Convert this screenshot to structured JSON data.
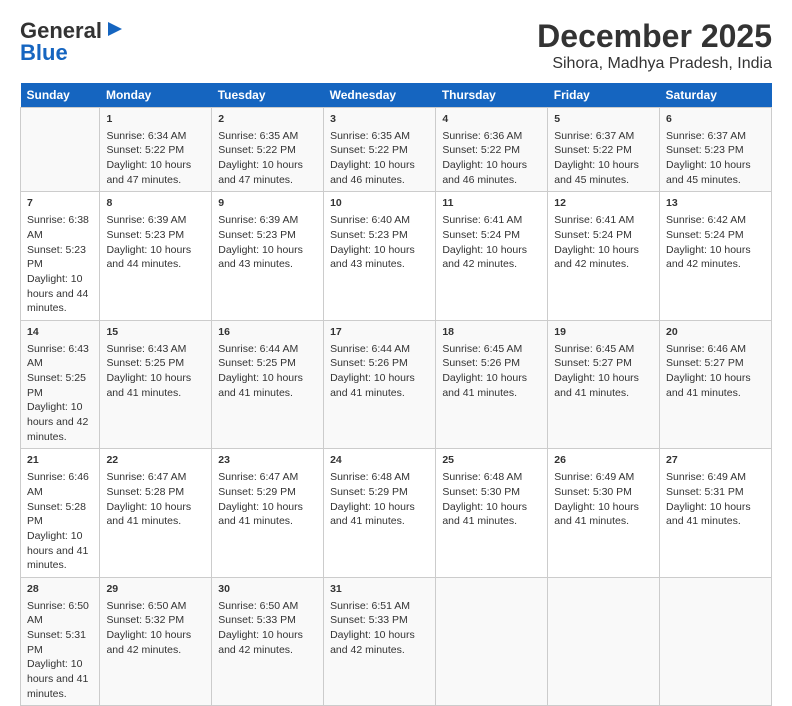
{
  "logo": {
    "line1": "General",
    "line2": "Blue"
  },
  "title": "December 2025",
  "subtitle": "Sihora, Madhya Pradesh, India",
  "days_header": [
    "Sunday",
    "Monday",
    "Tuesday",
    "Wednesday",
    "Thursday",
    "Friday",
    "Saturday"
  ],
  "weeks": [
    [
      {
        "day": "",
        "sunrise": "",
        "sunset": "",
        "daylight": ""
      },
      {
        "day": "1",
        "sunrise": "Sunrise: 6:34 AM",
        "sunset": "Sunset: 5:22 PM",
        "daylight": "Daylight: 10 hours and 47 minutes."
      },
      {
        "day": "2",
        "sunrise": "Sunrise: 6:35 AM",
        "sunset": "Sunset: 5:22 PM",
        "daylight": "Daylight: 10 hours and 47 minutes."
      },
      {
        "day": "3",
        "sunrise": "Sunrise: 6:35 AM",
        "sunset": "Sunset: 5:22 PM",
        "daylight": "Daylight: 10 hours and 46 minutes."
      },
      {
        "day": "4",
        "sunrise": "Sunrise: 6:36 AM",
        "sunset": "Sunset: 5:22 PM",
        "daylight": "Daylight: 10 hours and 46 minutes."
      },
      {
        "day": "5",
        "sunrise": "Sunrise: 6:37 AM",
        "sunset": "Sunset: 5:22 PM",
        "daylight": "Daylight: 10 hours and 45 minutes."
      },
      {
        "day": "6",
        "sunrise": "Sunrise: 6:37 AM",
        "sunset": "Sunset: 5:23 PM",
        "daylight": "Daylight: 10 hours and 45 minutes."
      }
    ],
    [
      {
        "day": "7",
        "sunrise": "Sunrise: 6:38 AM",
        "sunset": "Sunset: 5:23 PM",
        "daylight": "Daylight: 10 hours and 44 minutes."
      },
      {
        "day": "8",
        "sunrise": "Sunrise: 6:39 AM",
        "sunset": "Sunset: 5:23 PM",
        "daylight": "Daylight: 10 hours and 44 minutes."
      },
      {
        "day": "9",
        "sunrise": "Sunrise: 6:39 AM",
        "sunset": "Sunset: 5:23 PM",
        "daylight": "Daylight: 10 hours and 43 minutes."
      },
      {
        "day": "10",
        "sunrise": "Sunrise: 6:40 AM",
        "sunset": "Sunset: 5:23 PM",
        "daylight": "Daylight: 10 hours and 43 minutes."
      },
      {
        "day": "11",
        "sunrise": "Sunrise: 6:41 AM",
        "sunset": "Sunset: 5:24 PM",
        "daylight": "Daylight: 10 hours and 42 minutes."
      },
      {
        "day": "12",
        "sunrise": "Sunrise: 6:41 AM",
        "sunset": "Sunset: 5:24 PM",
        "daylight": "Daylight: 10 hours and 42 minutes."
      },
      {
        "day": "13",
        "sunrise": "Sunrise: 6:42 AM",
        "sunset": "Sunset: 5:24 PM",
        "daylight": "Daylight: 10 hours and 42 minutes."
      }
    ],
    [
      {
        "day": "14",
        "sunrise": "Sunrise: 6:43 AM",
        "sunset": "Sunset: 5:25 PM",
        "daylight": "Daylight: 10 hours and 42 minutes."
      },
      {
        "day": "15",
        "sunrise": "Sunrise: 6:43 AM",
        "sunset": "Sunset: 5:25 PM",
        "daylight": "Daylight: 10 hours and 41 minutes."
      },
      {
        "day": "16",
        "sunrise": "Sunrise: 6:44 AM",
        "sunset": "Sunset: 5:25 PM",
        "daylight": "Daylight: 10 hours and 41 minutes."
      },
      {
        "day": "17",
        "sunrise": "Sunrise: 6:44 AM",
        "sunset": "Sunset: 5:26 PM",
        "daylight": "Daylight: 10 hours and 41 minutes."
      },
      {
        "day": "18",
        "sunrise": "Sunrise: 6:45 AM",
        "sunset": "Sunset: 5:26 PM",
        "daylight": "Daylight: 10 hours and 41 minutes."
      },
      {
        "day": "19",
        "sunrise": "Sunrise: 6:45 AM",
        "sunset": "Sunset: 5:27 PM",
        "daylight": "Daylight: 10 hours and 41 minutes."
      },
      {
        "day": "20",
        "sunrise": "Sunrise: 6:46 AM",
        "sunset": "Sunset: 5:27 PM",
        "daylight": "Daylight: 10 hours and 41 minutes."
      }
    ],
    [
      {
        "day": "21",
        "sunrise": "Sunrise: 6:46 AM",
        "sunset": "Sunset: 5:28 PM",
        "daylight": "Daylight: 10 hours and 41 minutes."
      },
      {
        "day": "22",
        "sunrise": "Sunrise: 6:47 AM",
        "sunset": "Sunset: 5:28 PM",
        "daylight": "Daylight: 10 hours and 41 minutes."
      },
      {
        "day": "23",
        "sunrise": "Sunrise: 6:47 AM",
        "sunset": "Sunset: 5:29 PM",
        "daylight": "Daylight: 10 hours and 41 minutes."
      },
      {
        "day": "24",
        "sunrise": "Sunrise: 6:48 AM",
        "sunset": "Sunset: 5:29 PM",
        "daylight": "Daylight: 10 hours and 41 minutes."
      },
      {
        "day": "25",
        "sunrise": "Sunrise: 6:48 AM",
        "sunset": "Sunset: 5:30 PM",
        "daylight": "Daylight: 10 hours and 41 minutes."
      },
      {
        "day": "26",
        "sunrise": "Sunrise: 6:49 AM",
        "sunset": "Sunset: 5:30 PM",
        "daylight": "Daylight: 10 hours and 41 minutes."
      },
      {
        "day": "27",
        "sunrise": "Sunrise: 6:49 AM",
        "sunset": "Sunset: 5:31 PM",
        "daylight": "Daylight: 10 hours and 41 minutes."
      }
    ],
    [
      {
        "day": "28",
        "sunrise": "Sunrise: 6:50 AM",
        "sunset": "Sunset: 5:31 PM",
        "daylight": "Daylight: 10 hours and 41 minutes."
      },
      {
        "day": "29",
        "sunrise": "Sunrise: 6:50 AM",
        "sunset": "Sunset: 5:32 PM",
        "daylight": "Daylight: 10 hours and 42 minutes."
      },
      {
        "day": "30",
        "sunrise": "Sunrise: 6:50 AM",
        "sunset": "Sunset: 5:33 PM",
        "daylight": "Daylight: 10 hours and 42 minutes."
      },
      {
        "day": "31",
        "sunrise": "Sunrise: 6:51 AM",
        "sunset": "Sunset: 5:33 PM",
        "daylight": "Daylight: 10 hours and 42 minutes."
      },
      {
        "day": "",
        "sunrise": "",
        "sunset": "",
        "daylight": ""
      },
      {
        "day": "",
        "sunrise": "",
        "sunset": "",
        "daylight": ""
      },
      {
        "day": "",
        "sunrise": "",
        "sunset": "",
        "daylight": ""
      }
    ]
  ]
}
